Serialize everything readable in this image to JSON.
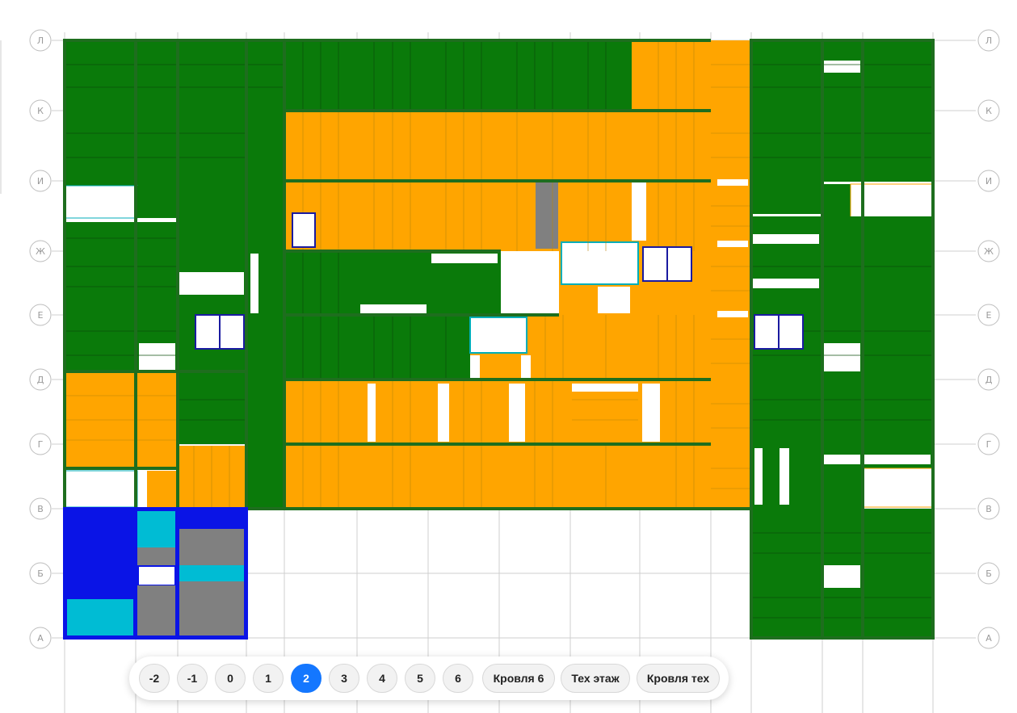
{
  "axes": {
    "rows": [
      "Л",
      "К",
      "И",
      "Ж",
      "Е",
      "Д",
      "Г",
      "В",
      "Б",
      "А"
    ]
  },
  "legend_colors": {
    "done": "#0a7a0a",
    "in_progress": "#ffa500",
    "special_blue": "#0a14e6",
    "special_cyan": "#00bcd4",
    "special_gray": "#808080",
    "active_floor": "#1477ff"
  },
  "floor_selector": {
    "floors": [
      "-2",
      "-1",
      "0",
      "1",
      "2",
      "3",
      "4",
      "5",
      "6",
      "Кровля 6",
      "Тех этаж",
      "Кровля тех"
    ],
    "active": "2"
  }
}
